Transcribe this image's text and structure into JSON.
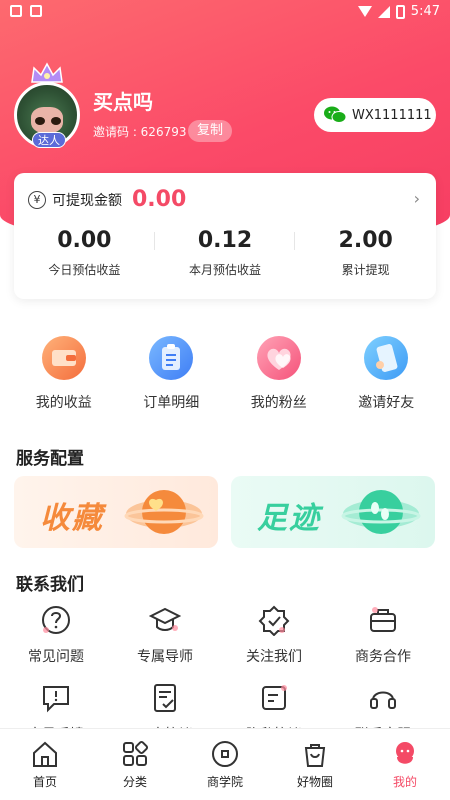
{
  "status_bar": {
    "time": "5:47"
  },
  "profile": {
    "username": "买点吗",
    "badge": "达人",
    "invite_label": "邀请码 : 626793",
    "copy_label": "复制",
    "wechat_id": "WX1111111"
  },
  "earnings": {
    "withdrawable_label": "可提现金额",
    "withdrawable_amount": "0.00",
    "yen_symbol": "¥",
    "stats": [
      {
        "value": "0.00",
        "label": "今日预估收益"
      },
      {
        "value": "0.12",
        "label": "本月预估收益"
      },
      {
        "value": "2.00",
        "label": "累计提现"
      }
    ]
  },
  "quick_actions": [
    {
      "label": "我的收益",
      "icon": "wallet-icon"
    },
    {
      "label": "订单明细",
      "icon": "clipboard-icon"
    },
    {
      "label": "我的粉丝",
      "icon": "hearts-icon"
    },
    {
      "label": "邀请好友",
      "icon": "phone-invite-icon"
    }
  ],
  "service": {
    "title": "服务配置",
    "cards": [
      {
        "label": "收藏",
        "color": "#f58a3c"
      },
      {
        "label": "足迹",
        "color": "#38cf9e"
      }
    ]
  },
  "contact": {
    "title": "联系我们",
    "items": [
      {
        "label": "常见问题",
        "icon": "question-icon"
      },
      {
        "label": "专属导师",
        "icon": "graduation-cap-icon"
      },
      {
        "label": "关注我们",
        "icon": "verified-icon"
      },
      {
        "label": "商务合作",
        "icon": "briefcase-icon"
      },
      {
        "label": "意见反馈",
        "icon": "feedback-icon"
      },
      {
        "label": "用户协议",
        "icon": "document-check-icon"
      },
      {
        "label": "隐私协议",
        "icon": "document-edit-icon"
      },
      {
        "label": "联系客服",
        "icon": "headset-icon"
      }
    ]
  },
  "tabbar": [
    {
      "label": "首页",
      "icon": "home-icon",
      "active": false
    },
    {
      "label": "分类",
      "icon": "category-icon",
      "active": false
    },
    {
      "label": "商学院",
      "icon": "school-icon",
      "active": false
    },
    {
      "label": "好物圈",
      "icon": "bag-icon",
      "active": false
    },
    {
      "label": "我的",
      "icon": "profile-icon",
      "active": true
    }
  ],
  "colors": {
    "brand": "#f44a66",
    "hero": "#fb4a68"
  }
}
